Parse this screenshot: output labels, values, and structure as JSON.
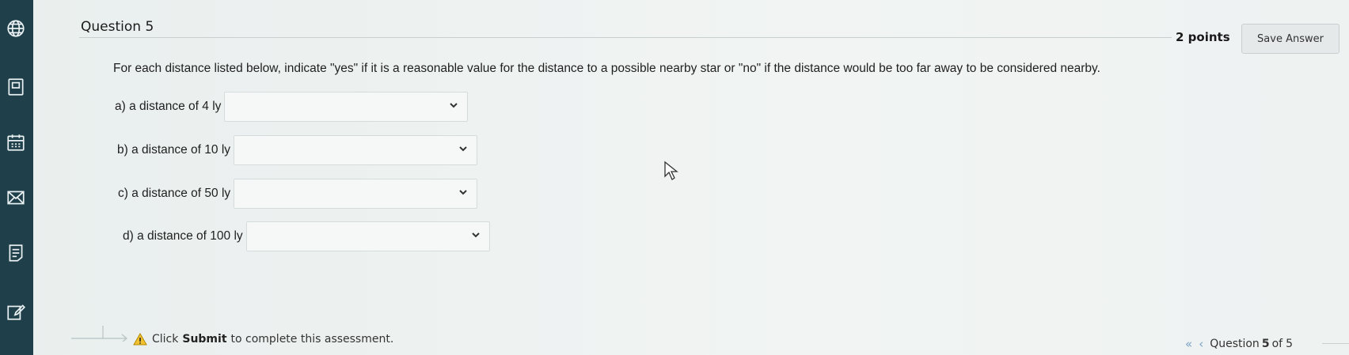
{
  "question": {
    "title": "Question 5",
    "points": "2 points",
    "save_label": "Save Answer",
    "prompt": "For each distance listed below, indicate \"yes\" if it is a reasonable value for the distance to a possible nearby star or \"no\" if the distance would be too far away to be considered nearby.",
    "items": [
      {
        "label": "a) a distance of 4 ly",
        "value": ""
      },
      {
        "label": "b) a distance of 10 ly",
        "value": ""
      },
      {
        "label": "c) a distance of 50 ly",
        "value": ""
      },
      {
        "label": "d) a distance of 100 ly",
        "value": ""
      }
    ]
  },
  "footer": {
    "click_text": "Click",
    "submit_text": "Submit",
    "rest_text": "to complete this assessment."
  },
  "pager": {
    "prefix": "Question",
    "current": "5",
    "of_text": "of",
    "total": "5",
    "first_icon": "double-chevron-left-icon",
    "prev_icon": "chevron-left-icon"
  },
  "sidebar": {
    "icons": [
      "globe-icon",
      "book-icon",
      "calendar-icon",
      "mail-icon",
      "notes-icon",
      "edit-icon"
    ]
  },
  "colors": {
    "sidebar": "#1f3f4a",
    "nav_accent": "#7aa3c8",
    "warning": "#e0a000"
  }
}
